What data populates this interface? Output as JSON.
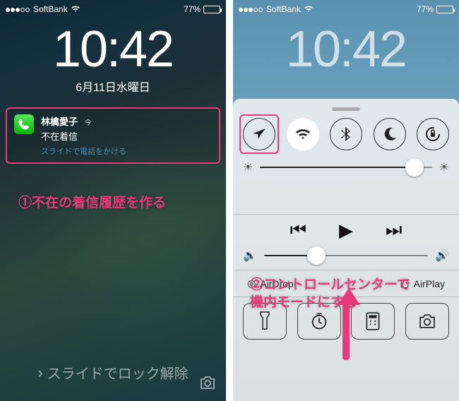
{
  "statusbar": {
    "carrier": "SoftBank",
    "battery_pct": "77%"
  },
  "clock": {
    "time": "10:42",
    "date": "6月11日水曜日"
  },
  "notification": {
    "caller": "林檎愛子",
    "time_label": "今",
    "status": "不在着信",
    "slide_hint": "スライドで電話をかける"
  },
  "annotations": {
    "step1": "①不在の着信履歴を作る",
    "step2_l1": "②コントロールセンターで",
    "step2_l2": "機内モードにする"
  },
  "unlock": {
    "text": "スライドでロック解除"
  },
  "control_center": {
    "toggles": {
      "airplane": "airplane-icon",
      "wifi": "wifi-icon",
      "bluetooth": "bluetooth-icon",
      "dnd": "moon-icon",
      "lock_rotation": "rotation-lock-icon"
    },
    "brightness_pct": 90,
    "volume_pct": 32,
    "airdrop_label": "AirDrop",
    "airplay_label": "AirPlay",
    "shortcuts": {
      "flashlight": "flashlight-icon",
      "timer": "timer-icon",
      "calculator": "calculator-icon",
      "camera": "camera-icon"
    }
  },
  "colors": {
    "highlight": "#e83a7a"
  }
}
